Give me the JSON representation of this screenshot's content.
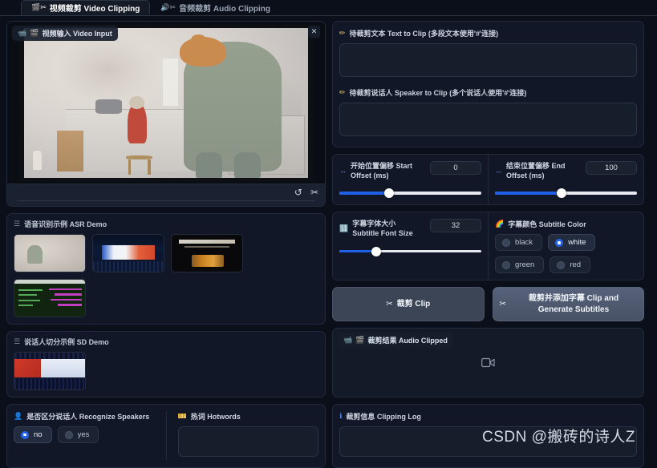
{
  "tabs": [
    {
      "label": "视频裁剪 Video Clipping",
      "icons": "🎬✂",
      "active": true
    },
    {
      "label": "音频裁剪 Audio Clipping",
      "icons": "🔊✂",
      "active": false
    }
  ],
  "video_input": {
    "label": "视频输入 Video Input",
    "camera_icon": "📹",
    "film_icon": "🎬",
    "close": "✕",
    "tools": {
      "undo": "↺",
      "trim": "✂"
    },
    "sources": {
      "upload": "⬆",
      "webcam": "◎"
    }
  },
  "asr_demo": {
    "title": "语音识别示例 ASR Demo",
    "bars_icon": "☰",
    "thumbs": [
      "demo-kitchen",
      "demo-stage",
      "demo-poster",
      "demo-terminal"
    ]
  },
  "sd_demo": {
    "title": "说话人切分示例 SD Demo",
    "bars_icon": "☰",
    "thumbs": [
      "demo-conference"
    ]
  },
  "recognize_speakers": {
    "label": "是否区分说话人 Recognize Speakers",
    "icon": "👤",
    "options": [
      {
        "label": "no",
        "selected": true
      },
      {
        "label": "yes",
        "selected": false
      }
    ]
  },
  "hotwords": {
    "label": "热词 Hotwords",
    "icon": "🎫",
    "value": "",
    "placeholder": ""
  },
  "text_to_clip": {
    "label": "待裁剪文本 Text to Clip (多段文本使用'#'连接)",
    "icon": "✏",
    "value": "",
    "placeholder": ""
  },
  "speaker_to_clip": {
    "label": "待裁剪说话人 Speaker to Clip (多个说话人使用'#'连接)",
    "icon": "✏",
    "value": "",
    "placeholder": ""
  },
  "start_offset": {
    "label": "开始位置偏移 Start Offset (ms)",
    "icon": "↔",
    "value": "0",
    "percent": 35
  },
  "end_offset": {
    "label": "结束位置偏移 End Offset (ms)",
    "icon": "↔",
    "value": "100",
    "percent": 47
  },
  "subtitle_font_size": {
    "label": "字幕字体大小 Subtitle Font Size",
    "icon": "🔢",
    "value": "32",
    "percent": 26
  },
  "subtitle_color": {
    "label": "字幕颜色 Subtitle Color",
    "icon": "🌈",
    "options": [
      {
        "label": "black",
        "selected": false
      },
      {
        "label": "white",
        "selected": true
      },
      {
        "label": "green",
        "selected": false
      },
      {
        "label": "red",
        "selected": false
      }
    ]
  },
  "actions": {
    "clip": {
      "label": "裁剪 Clip",
      "icon": "✂"
    },
    "clip_subtitles": {
      "label": "裁剪并添加字幕 Clip and Generate Subtitles",
      "icon": "✂"
    }
  },
  "audio_clipped": {
    "label": "裁剪结果 Audio Clipped",
    "camera_icon": "📹",
    "film_icon": "🎬",
    "placeholder_icon": "🎥"
  },
  "clipping_log": {
    "label": "裁剪信息 Clipping Log",
    "icon": "ℹ",
    "value": "",
    "placeholder": ""
  },
  "watermark": "CSDN @搬砖的诗人Z",
  "theme": {
    "background": "#0b0f19",
    "panel": "#111727",
    "accent": "#2563eb",
    "slider_fill": "#1f60e8",
    "upload_icon": "#f08a2a"
  }
}
